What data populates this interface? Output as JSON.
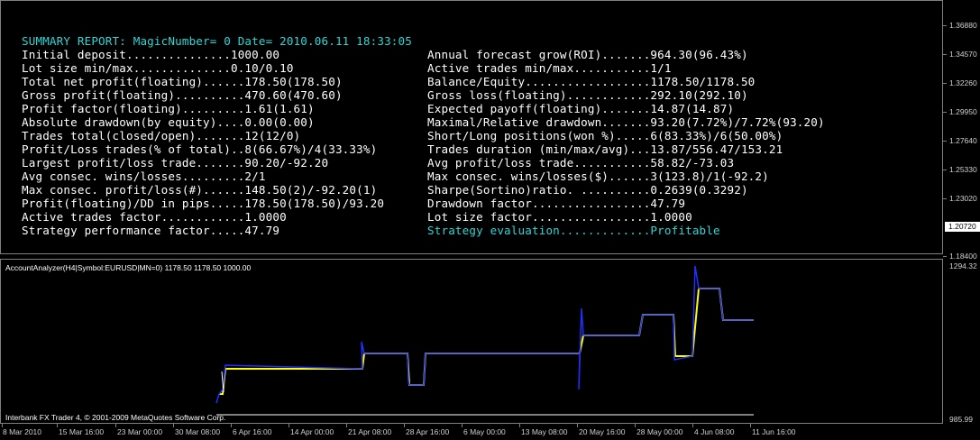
{
  "report": {
    "header": "SUMMARY REPORT: MagicNumber= 0 Date= 2010.06.11 18:33:05",
    "left": [
      "Initial deposit...............1000.00",
      "Lot size min/max..............0.10/0.10",
      "Total net profit(floating)......178.50(178.50)",
      "Gross profit(floating)..........470.60(470.60)",
      "Profit factor(floating).........1.61(1.61)",
      "Absolute drawdown(by equity)....0.00(0.00)",
      "Trades total(closed/open).......12(12/0)",
      "Profit/Loss trades(% of total)..8(66.67%)/4(33.33%)",
      "Largest profit/loss trade.......90.20/-92.20",
      "Avg consec. wins/losses.........2/1",
      "Max consec. profit/loss(#)......148.50(2)/-92.20(1)",
      "Profit(floating)/DD in pips.....178.50(178.50)/93.20",
      "Active trades factor............1.0000",
      "Strategy performance factor.....47.79"
    ],
    "right": [
      "Annual forecast grow(ROI).......964.30(96.43%)",
      "Active trades min/max...........1/1",
      "Balance/Equity..................1178.50/1178.50",
      "Gross loss(floating)............292.10(292.10)",
      "Expected payoff(floating).......14.87(14.87)",
      "Maximal/Relative drawdown.......93.20(7.72%)/7.72%(93.20)",
      "Short/Long positions(won %).....6(83.33%)/6(50.00%)",
      "Trades duration (min/max/avg)...13.87/556.47/153.21",
      "Avg profit/loss trade...........58.82/-73.03",
      "Max consec. wins/losses($)......3(123.8)/1(-92.2)",
      "Sharpe(Sortino)ratio. ..........0.2639(0.3292)",
      "Drawdown factor.................47.79",
      "Lot size factor.................1.0000",
      "Strategy evaluation.............Profitable"
    ]
  },
  "price_scale": {
    "ticks": [
      "1.36880",
      "1.34570",
      "1.32260",
      "1.29950",
      "1.27640",
      "1.25330",
      "1.23020",
      "1.18400"
    ],
    "current_price": "1.20720"
  },
  "indicator": {
    "label": "AccountAnalyzer(H4|Symbol:EURUSD|MN=0) 1178.50 1178.50 1000.00",
    "scale_top": "1294.32",
    "scale_bottom": "985.99"
  },
  "copyright": "Interbank FX Trader 4, © 2001-2009 MetaQuotes Software Corp.",
  "time_axis": [
    "8 Mar 2010",
    "15 Mar 16:00",
    "23 Mar 00:00",
    "30 Mar 08:00",
    "6 Apr 16:00",
    "14 Apr 00:00",
    "21 Apr 08:00",
    "28 Apr 16:00",
    "6 May 00:00",
    "13 May 08:00",
    "20 May 16:00",
    "28 May 00:00",
    "4 Jun 08:00",
    "11 Jun 16:00"
  ],
  "colors": {
    "balance": "#ffff00",
    "equity": "#2030ff",
    "base": "#ffffff",
    "header": "#2fd6d6",
    "text": "#ffffff"
  }
}
